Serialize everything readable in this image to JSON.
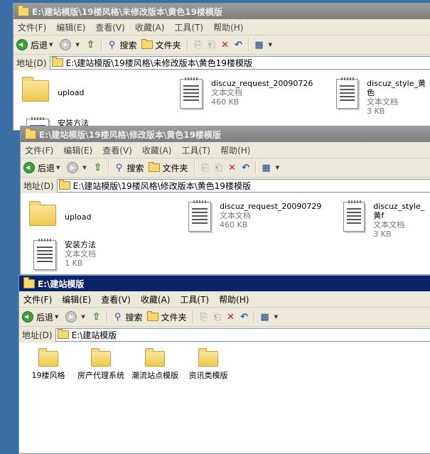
{
  "windows": [
    {
      "title": "E:\\建站模版\\19楼风格\\未修改版本\\黄色19楼模版",
      "menu": [
        "文件(F)",
        "编辑(E)",
        "查看(V)",
        "收藏(A)",
        "工具(T)",
        "帮助(H)"
      ],
      "toolbar": {
        "back": "后退",
        "search": "搜索",
        "folders": "文件夹"
      },
      "address_label": "地址(D)",
      "address": "E:\\建站模版\\19楼风格\\未修改版本\\黄色19楼模版",
      "files": [
        {
          "name": "upload",
          "kind": "folder"
        },
        {
          "name": "discuz_request_20090726",
          "type": "文本文档",
          "size": "460 KB"
        },
        {
          "name": "discuz_style_黄色",
          "type": "文本文档",
          "size": "3 KB"
        },
        {
          "name": "安装方法",
          "type": "",
          "size": ""
        }
      ]
    },
    {
      "title": "E:\\建站模版\\19楼风格\\修改版本\\黄色19楼模版",
      "menu": [
        "文件(F)",
        "编辑(E)",
        "查看(V)",
        "收藏(A)",
        "工具(T)",
        "帮助(H)"
      ],
      "toolbar": {
        "back": "后退",
        "search": "搜索",
        "folders": "文件夹"
      },
      "address_label": "地址(D)",
      "address": "E:\\建站模版\\19楼风格\\修改版本\\黄色19楼模版",
      "files": [
        {
          "name": "upload",
          "kind": "folder"
        },
        {
          "name": "discuz_request_20090729",
          "type": "文本文档",
          "size": "460 KB"
        },
        {
          "name": "discuz_style_黄f",
          "type": "文本文档",
          "size": "3 KB"
        },
        {
          "name": "安装方法",
          "type": "文本文档",
          "size": "1 KB"
        }
      ]
    },
    {
      "title": "E:\\建站模版",
      "menu": [
        "文件(F)",
        "编辑(E)",
        "查看(V)",
        "收藏(A)",
        "工具(T)",
        "帮助(H)"
      ],
      "toolbar": {
        "back": "后退",
        "search": "搜索",
        "folders": "文件夹"
      },
      "address_label": "地址(D)",
      "address": "E:\\建站模版",
      "folders": [
        "19楼风格",
        "房产代理系统",
        "潮流站点模版",
        "资讯类模版"
      ]
    }
  ],
  "colors": {
    "active_title": "#0a246a",
    "inactive_title": "#8c8c8c",
    "desktop": "#3a6ea5"
  }
}
